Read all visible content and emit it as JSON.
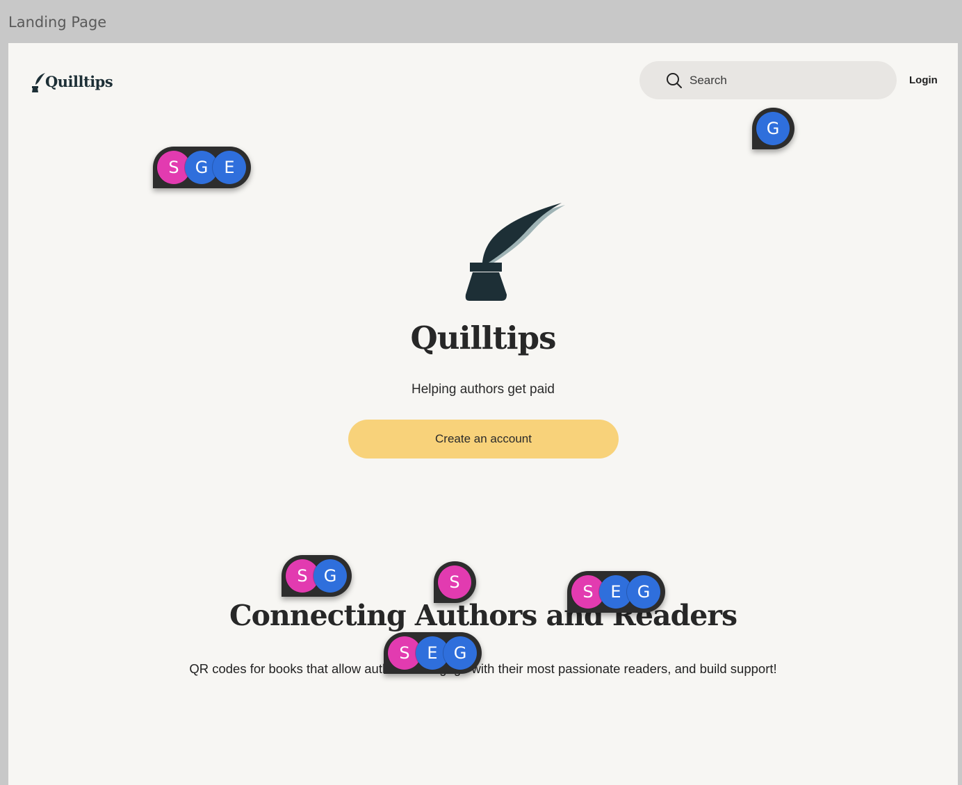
{
  "frame": {
    "title": "Landing Page"
  },
  "header": {
    "logo_text": "Quilltips",
    "search_placeholder": "Search",
    "login_label": "Login"
  },
  "hero": {
    "title": "Quilltips",
    "subtitle": "Helping authors get paid",
    "cta_label": "Create an account"
  },
  "section": {
    "title": "Connecting Authors and Readers",
    "body": "QR codes for books that allow authors to engage with their most passionate readers, and build support!"
  },
  "presence": {
    "colors": {
      "S": "#e23bb0",
      "G": "#2f6fdc",
      "E": "#2f6fdc"
    },
    "cursors": [
      {
        "users": [
          "G"
        ]
      },
      {
        "users": [
          "S",
          "G",
          "E"
        ]
      },
      {
        "users": [
          "S",
          "G"
        ]
      },
      {
        "users": [
          "S"
        ]
      },
      {
        "users": [
          "S",
          "E",
          "G"
        ]
      },
      {
        "users": [
          "S",
          "E",
          "G"
        ]
      }
    ]
  },
  "colors": {
    "brand_dark": "#1d2f36",
    "cta_yellow": "#f8d27a",
    "page_bg": "#f7f6f3"
  }
}
